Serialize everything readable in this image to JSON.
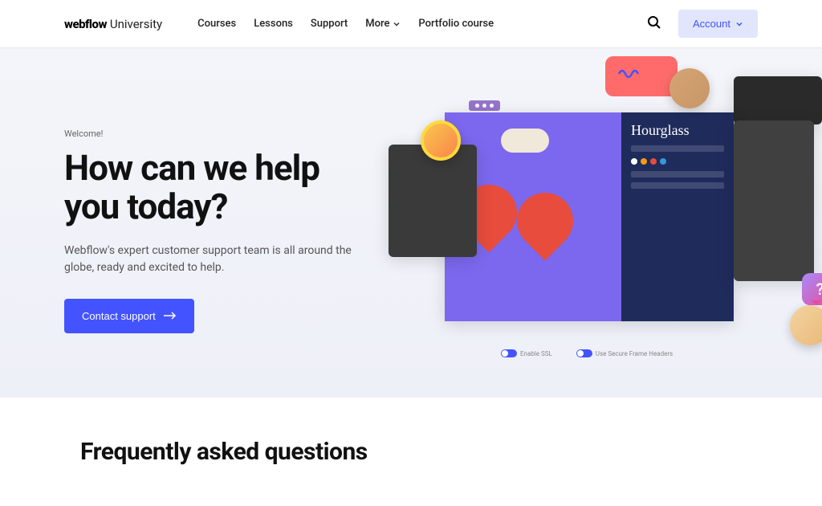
{
  "header": {
    "logo_brand": "webflow",
    "logo_suffix": "University",
    "nav": [
      "Courses",
      "Lessons",
      "Support",
      "More",
      "Portfolio course"
    ],
    "account_label": "Account"
  },
  "hero": {
    "eyebrow": "Welcome!",
    "title": "How can we help you today?",
    "description": "Webflow's expert customer support team is all around the globe, ready and excited to help.",
    "cta_label": "Contact support",
    "mockup": {
      "side_title": "Hourglass",
      "toggle1": "Enable SSL",
      "toggle2": "Use Secure Frame Headers",
      "bubble_question": "?"
    }
  },
  "faq": {
    "title": "Frequently asked questions"
  }
}
